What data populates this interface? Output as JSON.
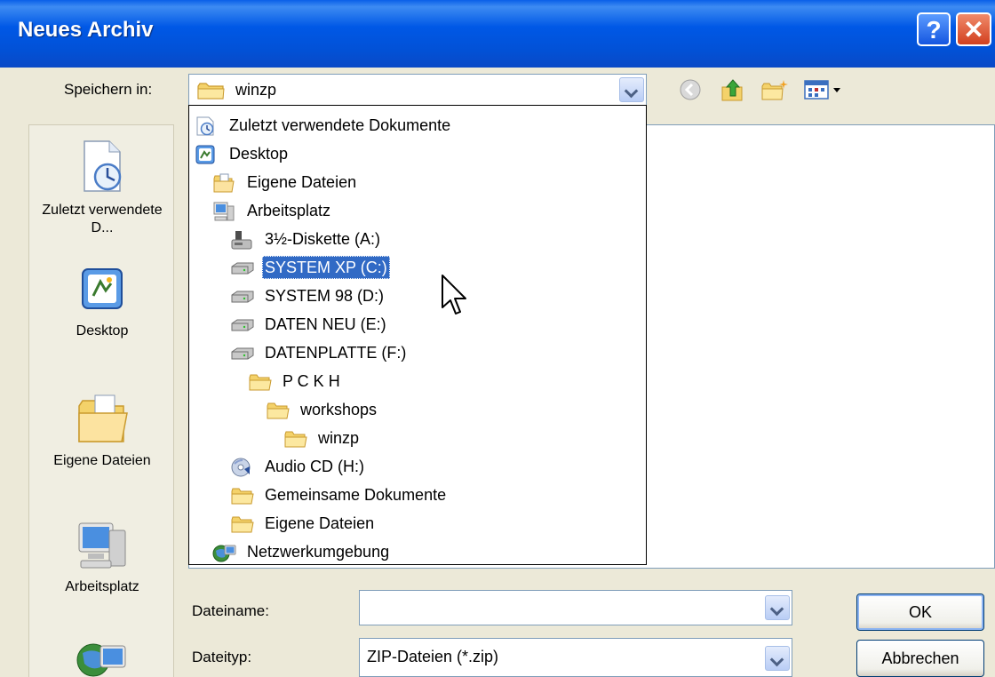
{
  "window": {
    "title": "Neues Archiv"
  },
  "titlebar": {
    "help_label": "?",
    "close_label": "✕"
  },
  "toolbar": {
    "save_in_label": "Speichern in:",
    "current_folder": "winzp",
    "icons": [
      "back-icon",
      "up-folder-icon",
      "new-folder-icon",
      "view-menu-icon"
    ]
  },
  "places": [
    {
      "label": "Zuletzt verwendete D...",
      "icon": "recent-documents-icon"
    },
    {
      "label": "Desktop",
      "icon": "desktop-icon"
    },
    {
      "label": "Eigene Dateien",
      "icon": "my-documents-icon"
    },
    {
      "label": "Arbeitsplatz",
      "icon": "my-computer-icon"
    },
    {
      "label": "",
      "icon": "network-icon"
    }
  ],
  "dropdown": {
    "items": [
      {
        "label": "Zuletzt verwendete Dokumente",
        "icon": "recent-documents-icon",
        "level": 0
      },
      {
        "label": "Desktop",
        "icon": "desktop-icon",
        "level": 0
      },
      {
        "label": "Eigene Dateien",
        "icon": "my-documents-icon",
        "level": 1
      },
      {
        "label": "Arbeitsplatz",
        "icon": "my-computer-icon",
        "level": 1
      },
      {
        "label": "3½-Diskette (A:)",
        "icon": "floppy-icon",
        "level": 2
      },
      {
        "label": "SYSTEM XP (C:)",
        "icon": "hard-drive-icon",
        "level": 2,
        "selected": true
      },
      {
        "label": "SYSTEM 98 (D:)",
        "icon": "hard-drive-icon",
        "level": 2
      },
      {
        "label": "DATEN NEU (E:)",
        "icon": "hard-drive-icon",
        "level": 2
      },
      {
        "label": "DATENPLATTE (F:)",
        "icon": "hard-drive-icon",
        "level": 2
      },
      {
        "label": "P C K H",
        "icon": "folder-icon",
        "level": 3
      },
      {
        "label": "workshops",
        "icon": "folder-icon",
        "level": 4
      },
      {
        "label": "winzp",
        "icon": "folder-icon",
        "level": 5
      },
      {
        "label": "Audio CD (H:)",
        "icon": "cd-icon",
        "level": 2
      },
      {
        "label": "Gemeinsame Dokumente",
        "icon": "folder-icon",
        "level": 2
      },
      {
        "label": "Eigene Dateien",
        "icon": "folder-icon",
        "level": 2
      },
      {
        "label": "Netzwerkumgebung",
        "icon": "network-icon",
        "level": 1
      }
    ]
  },
  "form": {
    "filename_label": "Dateiname:",
    "filename_value": "",
    "filetype_label": "Dateityp:",
    "filetype_value": "ZIP-Dateien (*.zip)",
    "ok_label": "OK",
    "cancel_label": "Abbrechen"
  },
  "colors": {
    "titlebar": "#0058E6",
    "dialog_bg": "#ECE9D8",
    "selection": "#316AC5",
    "field_border": "#7F9DB9"
  }
}
